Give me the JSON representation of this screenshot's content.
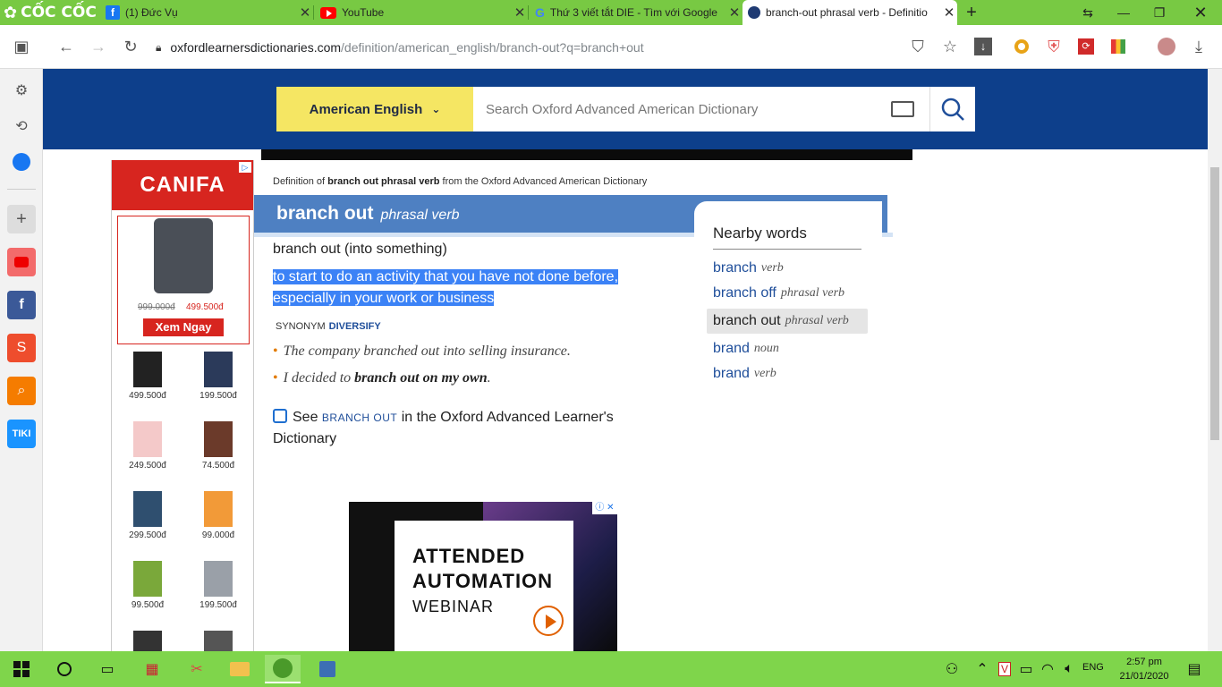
{
  "browser": {
    "brand": "CỐC CỐC",
    "tabs": [
      {
        "title": "(1) Đức Vụ",
        "icon": "facebook-icon"
      },
      {
        "title": "YouTube",
        "icon": "youtube-icon"
      },
      {
        "title": "Thứ 3 viết tắt DIE - Tìm với Google",
        "icon": "google-icon"
      },
      {
        "title": "branch-out phrasal verb - Definitio",
        "icon": "oxford-icon",
        "active": true
      }
    ],
    "url_host": "oxfordlearnersdictionaries.com",
    "url_path": "/definition/american_english/branch-out?q=branch+out"
  },
  "header": {
    "language": "American English",
    "search_placeholder": "Search Oxford Advanced American Dictionary"
  },
  "ad_left": {
    "brand": "CANIFA",
    "featured_old_price": "999.000đ",
    "featured_new_price": "499.500đ",
    "cta": "Xem Ngay",
    "products": [
      {
        "price": "499.500đ"
      },
      {
        "price": "199.500đ"
      },
      {
        "price": "249.500đ"
      },
      {
        "price": "74.500đ"
      },
      {
        "price": "299.500đ"
      },
      {
        "price": "99.000đ"
      },
      {
        "price": "99.500đ"
      },
      {
        "price": "199.500đ"
      }
    ]
  },
  "entry": {
    "def_prefix": "Definition of",
    "def_word": "branch out phrasal verb",
    "def_suffix": "from the Oxford Advanced American Dictionary",
    "headword": "branch out",
    "pos": "phrasal verb",
    "phrase": "branch out (into something)",
    "definition": "to start to do an activity that you have not done before, especially in your work or business",
    "synonym_label": "SYNONYM",
    "synonym": "DIVERSIFY",
    "example1": "The company branched out into selling insurance.",
    "example2_pre": "I decided to",
    "example2_bold": "branch out on my own",
    "example2_post": ".",
    "see_pre": "See",
    "see_word": "BRANCH OUT",
    "see_post": "in the Oxford Advanced Learner's Dictionary"
  },
  "nearby": {
    "title": "Nearby words",
    "items": [
      {
        "word": "branch",
        "pos": "verb"
      },
      {
        "word": "branch off",
        "pos": "phrasal verb"
      },
      {
        "word": "branch out",
        "pos": "phrasal verb"
      },
      {
        "word": "brand",
        "pos": "noun"
      },
      {
        "word": "brand",
        "pos": "verb"
      }
    ]
  },
  "video_ad": {
    "line1": "ATTENDED",
    "line2": "AUTOMATION",
    "line3": "WEBINAR"
  },
  "taskbar": {
    "lang": "ENG",
    "time": "2:57 pm",
    "date": "21/01/2020"
  },
  "colors": {
    "header": "#0d3f8b",
    "headword_bar": "#4e80c2",
    "lang_selector": "#f5e663",
    "selection": "#3b82f6",
    "taskbar": "#7fd54b"
  }
}
